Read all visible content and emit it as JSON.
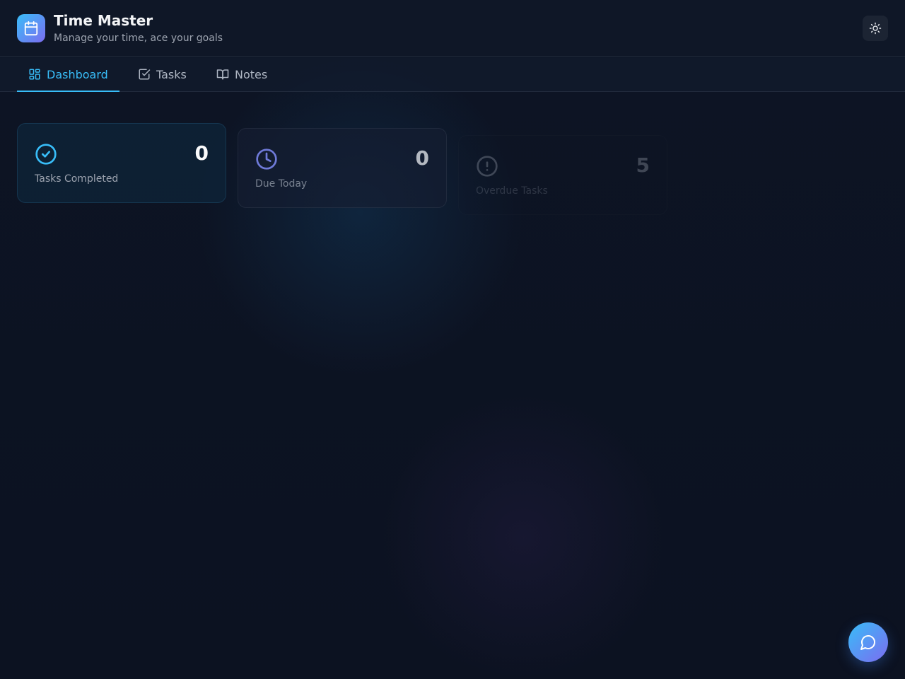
{
  "app": {
    "title": "Time Master",
    "subtitle": "Manage your time, ace your goals",
    "logo_icon": "calendar-icon",
    "theme_toggle_icon": "sun-icon"
  },
  "nav": {
    "tabs": [
      {
        "label": "Dashboard",
        "icon": "dashboard-grid-icon",
        "active": true
      },
      {
        "label": "Tasks",
        "icon": "checkbox-icon",
        "active": false
      },
      {
        "label": "Notes",
        "icon": "book-icon",
        "active": false
      }
    ]
  },
  "stats": [
    {
      "label": "Tasks Completed",
      "value": "0",
      "icon": "check-circle-icon",
      "color": "#38bdf8"
    },
    {
      "label": "Due Today",
      "value": "0",
      "icon": "clock-icon",
      "color": "#818cf8"
    },
    {
      "label": "Overdue Tasks",
      "value": "5",
      "icon": "alert-circle-icon",
      "color": "#9ca3af"
    }
  ],
  "chat_button": {
    "icon": "chat-bubble-icon"
  },
  "colors": {
    "accent": "#38bdf8",
    "accent_secondary": "#7c6cf0",
    "background": "#0c1322"
  }
}
